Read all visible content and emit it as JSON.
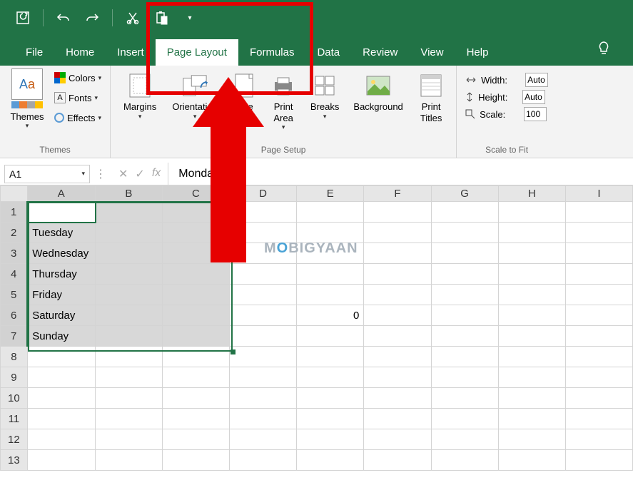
{
  "qat": {
    "icons": [
      "save-refresh",
      "undo",
      "redo",
      "cut",
      "paste",
      "more"
    ]
  },
  "menu": {
    "tabs": [
      "File",
      "Home",
      "Insert",
      "Page Layout",
      "Formulas",
      "Data",
      "Review",
      "View",
      "Help"
    ],
    "active": "Page Layout"
  },
  "ribbon": {
    "themes": {
      "label": "Themes",
      "button": "Themes",
      "colors": "Colors",
      "fonts": "Fonts",
      "effects": "Effects"
    },
    "pagesetup": {
      "label": "Page Setup",
      "margins": "Margins",
      "orientation": "Orientation",
      "size": "Size",
      "printarea": "Print\nArea",
      "breaks": "Breaks",
      "background": "Background",
      "printtitles": "Print\nTitles"
    },
    "scale": {
      "label": "Scale to Fit",
      "width": "Width:",
      "height": "Height:",
      "scale": "Scale:",
      "width_val": "Auto",
      "height_val": "Auto",
      "scale_val": "100"
    }
  },
  "namebox": "A1",
  "formula": "Monday",
  "columns": [
    "A",
    "B",
    "C",
    "D",
    "E",
    "F",
    "G",
    "H",
    "I"
  ],
  "rows": [
    "1",
    "2",
    "3",
    "4",
    "5",
    "6",
    "7",
    "8",
    "9",
    "10",
    "11",
    "12",
    "13"
  ],
  "cells": {
    "A1": "Monday",
    "A2": "Tuesday",
    "A3": "Wednesday",
    "A4": "Thursday",
    "A5": "Friday",
    "A6": "Saturday",
    "A7": "Sunday",
    "E6": "0"
  },
  "watermark": {
    "pre": "M",
    "o": "O",
    "post": "BIGYAAN"
  }
}
